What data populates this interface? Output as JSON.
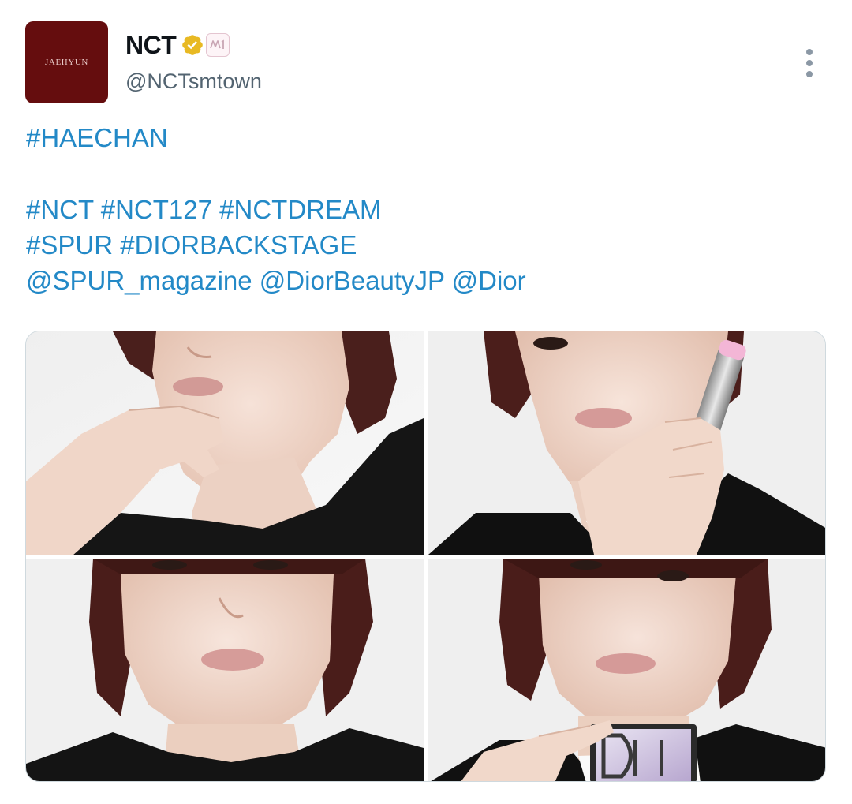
{
  "colors": {
    "link": "#2389c7",
    "avatar_bg": "#650d0e",
    "verified_gold": "#e8b923",
    "text_primary": "#0f1419",
    "text_secondary": "#536471"
  },
  "author": {
    "avatar_text": "JAEHYUN",
    "display_name": "NCT",
    "handle": "@NCTsmtown",
    "verified_icon": "gold-verified-check-icon",
    "affiliate_badge_icon": "sm-entertainment-badge-icon"
  },
  "tweet": {
    "line1": [
      "#HAECHAN"
    ],
    "line2": [
      "#NCT",
      "#NCT127",
      "#NCTDREAM"
    ],
    "line3": [
      "#SPUR",
      "#DIORBACKSTAGE"
    ],
    "line4": [
      "@SPUR_magazine",
      "@DiorBeautyJP",
      "@Dior"
    ]
  },
  "media": {
    "photos": [
      {
        "name": "photo-1"
      },
      {
        "name": "photo-2"
      },
      {
        "name": "photo-3"
      },
      {
        "name": "photo-4"
      }
    ]
  },
  "actions": {
    "more_icon": "more-vertical-icon"
  }
}
